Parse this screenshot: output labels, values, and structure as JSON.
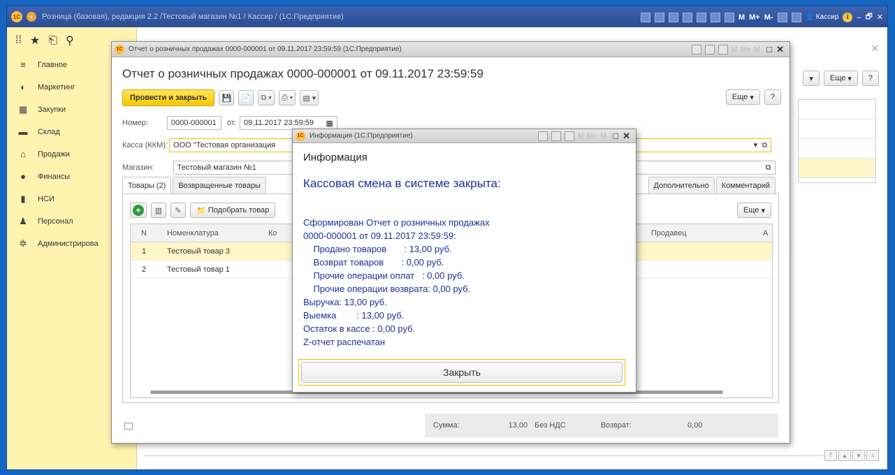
{
  "app": {
    "title": "Розница (базовая), редакция 2.2 /Тестовый магазин №1 / Кассир / (1С:Предприятие)",
    "user": "Кассир",
    "m_labels": [
      "M",
      "M+",
      "M-"
    ]
  },
  "sidebar": {
    "items": [
      {
        "label": "Главное",
        "icon": "menu-icon"
      },
      {
        "label": "Маркетинг",
        "icon": "marketing-icon"
      },
      {
        "label": "Закупки",
        "icon": "purchases-icon"
      },
      {
        "label": "Склад",
        "icon": "warehouse-icon"
      },
      {
        "label": "Продажи",
        "icon": "basket-icon"
      },
      {
        "label": "Финансы",
        "icon": "finance-icon"
      },
      {
        "label": "НСИ",
        "icon": "book-icon"
      },
      {
        "label": "Персонал",
        "icon": "person-icon"
      },
      {
        "label": "Администрирова",
        "icon": "gear-icon"
      }
    ]
  },
  "background_form": {
    "more_label": "Еще",
    "help_label": "?"
  },
  "report_window": {
    "window_title": "Отчет о розничных продажах 0000-000001 от 09.11.2017 23:59:59  (1С:Предприятие)",
    "doc_title": "Отчет о розничных продажах 0000-000001 от 09.11.2017 23:59:59",
    "post_close_label": "Провести и закрыть",
    "more_label": "Еще",
    "help_label": "?",
    "number_label": "Номер:",
    "number_value": "0000-000001",
    "from_label": "от:",
    "date_value": "09.11.2017 23:59:59",
    "kassa_label": "Касса (ККМ):",
    "kassa_value": "ООО \"Тестовая организация",
    "store_label": "Магазин:",
    "store_value": "Тестовый магазин №1",
    "tabs": [
      "Товары (2)",
      "Возвращенные товары"
    ],
    "tabs_right": [
      "Дополнительно",
      "Комментарий"
    ],
    "pick_label": "Подобрать товар",
    "panel_more_label": "Еще",
    "grid": {
      "headers": [
        "N",
        "Номенклатура",
        "Ко",
        "Продавец",
        "А"
      ],
      "rows": [
        {
          "n": "1",
          "name": "Тестовый товар 3"
        },
        {
          "n": "2",
          "name": "Тестовый товар 1"
        }
      ]
    },
    "footer": {
      "sum_label": "Сумма:",
      "sum_value": "13,00",
      "vat_label": "Без НДС",
      "return_label": "Возврат:",
      "return_value": "0,00"
    }
  },
  "dialog": {
    "window_title": "Информация  (1С:Предприятие)",
    "heading": "Информация",
    "subheading": "Кассовая смена в системе закрыта:",
    "body": "Сформирован Отчет о розничных продажах\n0000-000001 от 09.11.2017 23:59:59:\n    Продано товаров       : 13,00 руб.\n    Возврат товаров       : 0,00 руб.\n    Прочие операции оплат   : 0,00 руб.\n    Прочие операции возврата: 0,00 руб.\nВыручка: 13,00 руб.\nВыемка        : 13,00 руб.\nОстаток в кассе : 0,00 руб.\nZ-отчет распечатан",
    "close_label": "Закрыть"
  }
}
